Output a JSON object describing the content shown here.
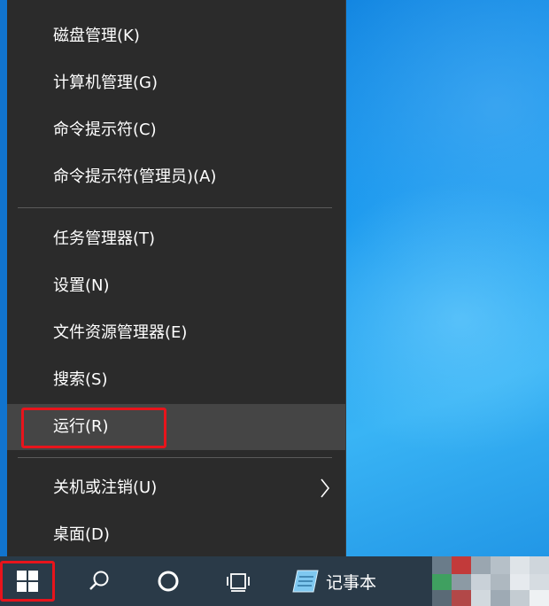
{
  "menu": {
    "items": [
      {
        "label": "磁盘管理(K)"
      },
      {
        "label": "计算机管理(G)"
      },
      {
        "label": "命令提示符(C)"
      },
      {
        "label": "命令提示符(管理员)(A)"
      },
      {
        "label": "任务管理器(T)"
      },
      {
        "label": "设置(N)"
      },
      {
        "label": "文件资源管理器(E)"
      },
      {
        "label": "搜索(S)"
      },
      {
        "label": "运行(R)"
      },
      {
        "label": "关机或注销(U)"
      },
      {
        "label": "桌面(D)"
      }
    ],
    "hovered_item": "运行(R)",
    "submenu_item": "关机或注销(U)"
  },
  "taskbar": {
    "start_icon": "windows-logo-icon",
    "search_icon": "search-icon",
    "cortana_icon": "cortana-circle-icon",
    "taskview_icon": "task-view-icon",
    "notepad": {
      "icon": "notepad-icon",
      "label": "记事本"
    }
  },
  "colors": {
    "menu_bg": "#2b2b2b",
    "hover_bg": "#454545",
    "highlight_border": "#e8141c",
    "taskbar_bg": "#2a3a48"
  }
}
